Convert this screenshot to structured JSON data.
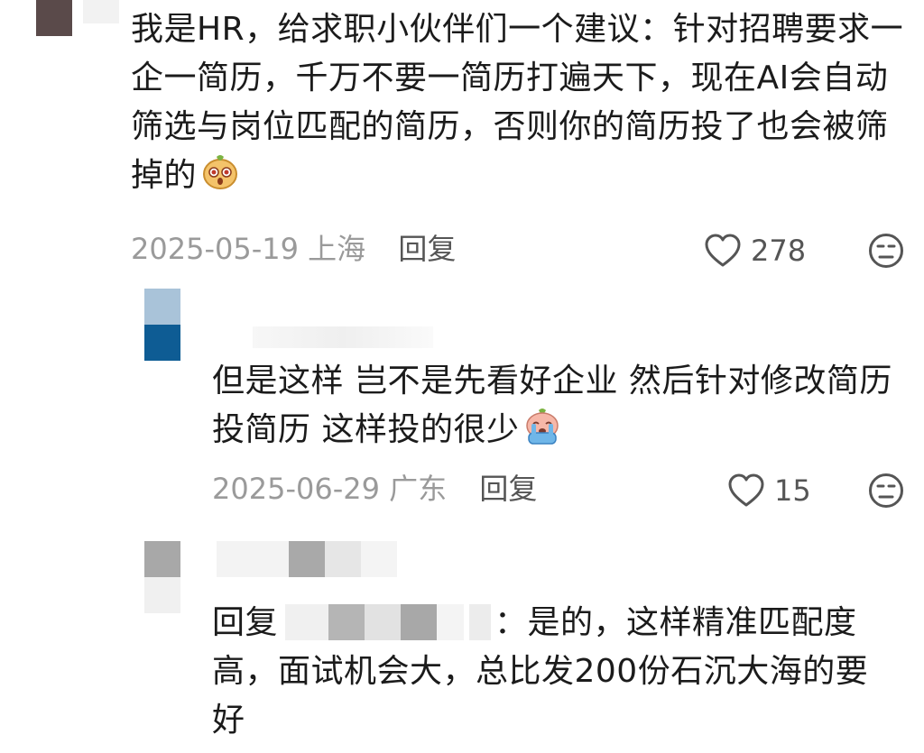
{
  "comments": [
    {
      "text": "我是HR，给求职小伙伴们一个建议：针对招聘要求一企一简历，千万不要一简历打遍天下，现在AI会自动筛选与岗位匹配的简历，否则你的简历投了也会被筛掉的",
      "emoji": "dog-face-emoji",
      "date": "2025-05-19",
      "location": "上海",
      "reply_label": "回复",
      "likes": "278"
    }
  ],
  "replies": [
    {
      "text": "但是这样 岂不是先看好企业 然后针对修改简历 投简历 这样投的很少",
      "emoji": "crying-face-emoji",
      "date": "2025-06-29",
      "location": "广东",
      "reply_label": "回复",
      "likes": "15"
    },
    {
      "prefix": "回复",
      "text": "：是的，这样精准匹配度高，面试机会大，总比发200份石沉大海的要好"
    }
  ],
  "colors": {
    "text": "#1b1b1b",
    "meta": "#9a9a9a",
    "icon": "#555555"
  }
}
